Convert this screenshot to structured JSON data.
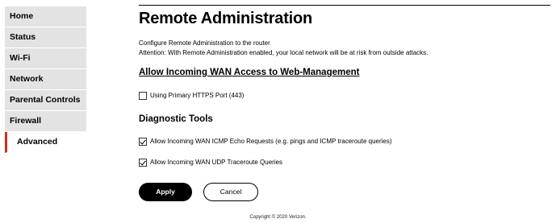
{
  "sidebar": {
    "items": [
      {
        "label": "Home"
      },
      {
        "label": "Status"
      },
      {
        "label": "Wi-Fi"
      },
      {
        "label": "Network"
      },
      {
        "label": "Parental Controls"
      },
      {
        "label": "Firewall"
      },
      {
        "label": "Advanced"
      }
    ],
    "active_color": "#d52b1e"
  },
  "main": {
    "title": "Remote Administration",
    "description_line1": "Configure Remote Administration to the router",
    "description_line2": "Attention: With Remote Administration enabled, your local network will be at risk from outside attacks.",
    "wan_section": {
      "heading": "Allow Incoming WAN Access to Web-Management",
      "https_port_label": "Using Primary HTTPS Port (443)",
      "https_port_checked": false
    },
    "diagnostic_section": {
      "heading": "Diagnostic Tools",
      "icmp_label": "Allow Incoming WAN ICMP Echo Requests (e.g. pings and ICMP traceroute queries)",
      "icmp_checked": true,
      "udp_label": "Allow Incoming WAN UDP Traceroute Queries",
      "udp_checked": true
    },
    "apply_label": "Apply",
    "cancel_label": "Cancel"
  },
  "footer": {
    "copyright": "Copyright © 2020 Verizon."
  }
}
